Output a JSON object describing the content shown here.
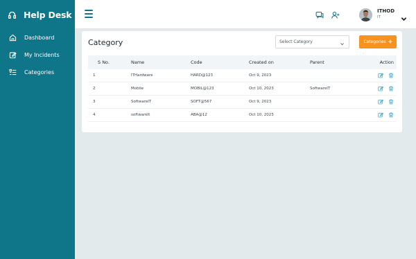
{
  "brand": {
    "name": "Help Desk",
    "icon": "headset-icon"
  },
  "sidebar": {
    "items": [
      {
        "label": "Dashboard",
        "icon": "home-icon"
      },
      {
        "label": "My Incidents",
        "icon": "edit-icon"
      },
      {
        "label": "Categories",
        "icon": "list-icon"
      }
    ]
  },
  "header": {
    "icons": [
      "chat-icon",
      "add-user-icon"
    ],
    "user": {
      "name": "ITHOD",
      "role": "IT"
    }
  },
  "card": {
    "title": "Category",
    "select_placeholder": "Select Category",
    "button_label": "Categories"
  },
  "table": {
    "columns": [
      "S No.",
      "Name",
      "Code",
      "Created on",
      "Parent",
      "Action"
    ],
    "rows": [
      {
        "sno": "1",
        "name": "ITHardware",
        "code": "HARD@123",
        "created": "Oct 9, 2023",
        "parent": ""
      },
      {
        "sno": "2",
        "name": "Mobile",
        "code": "MOBIL@123",
        "created": "Oct 10, 2023",
        "parent": "SoftwareIT"
      },
      {
        "sno": "3",
        "name": "SoftwareIT",
        "code": "SOFT@567",
        "created": "Oct 9, 2023",
        "parent": ""
      },
      {
        "sno": "4",
        "name": "softwareIt",
        "code": "ABA@12",
        "created": "Oct 10, 2023",
        "parent": ""
      }
    ]
  },
  "colors": {
    "sidebar": "#0f7589",
    "accent": "#f7921e",
    "background": "#e2eaeb",
    "action_icon": "#3aa7c8"
  }
}
